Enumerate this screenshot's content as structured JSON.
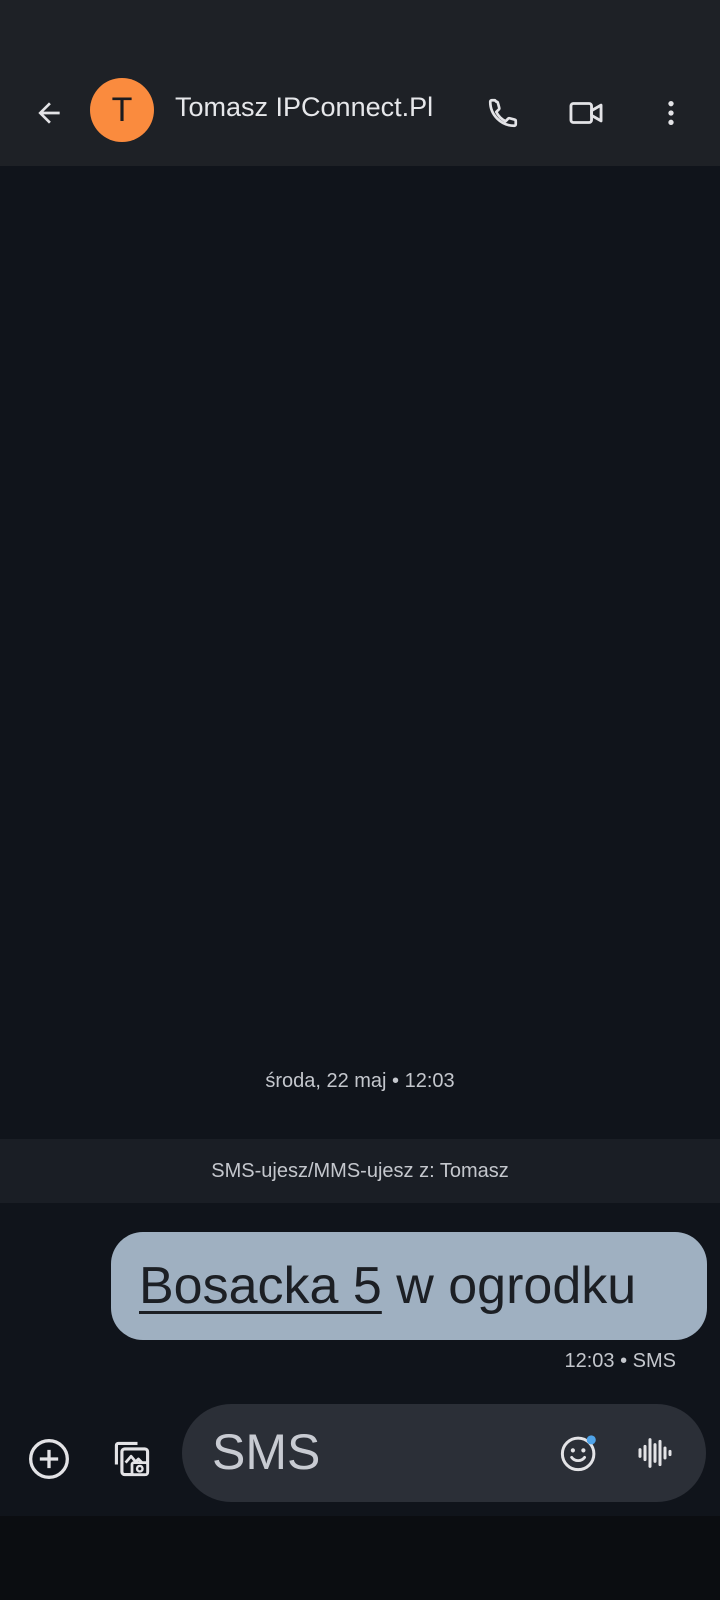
{
  "header": {
    "contact_name": "Tomasz IPConnect.Pl",
    "avatar_initial": "T",
    "avatar_color": "#fa8b3e",
    "icons": [
      "arrow-back-icon",
      "phone-icon",
      "videocam-icon",
      "more-vert-icon"
    ]
  },
  "conversation": {
    "date_separator": "środa, 22 maj • 12:03",
    "info_banner": "SMS-ujesz/MMS-ujesz z: Tomasz",
    "messages": [
      {
        "direction": "outgoing",
        "link_text": "Bosacka 5",
        "rest_text": " w ogrodku",
        "meta": "12:03 • SMS"
      }
    ]
  },
  "composer": {
    "placeholder": "SMS",
    "icons": [
      "add-circle-icon",
      "gallery-icon",
      "emoji-icon",
      "voice-waveform-icon"
    ]
  },
  "colors": {
    "background": "#10141b",
    "app_bar": "#1e2126",
    "bubble": "#9fb0c1",
    "compose_field": "#2b2f37"
  }
}
